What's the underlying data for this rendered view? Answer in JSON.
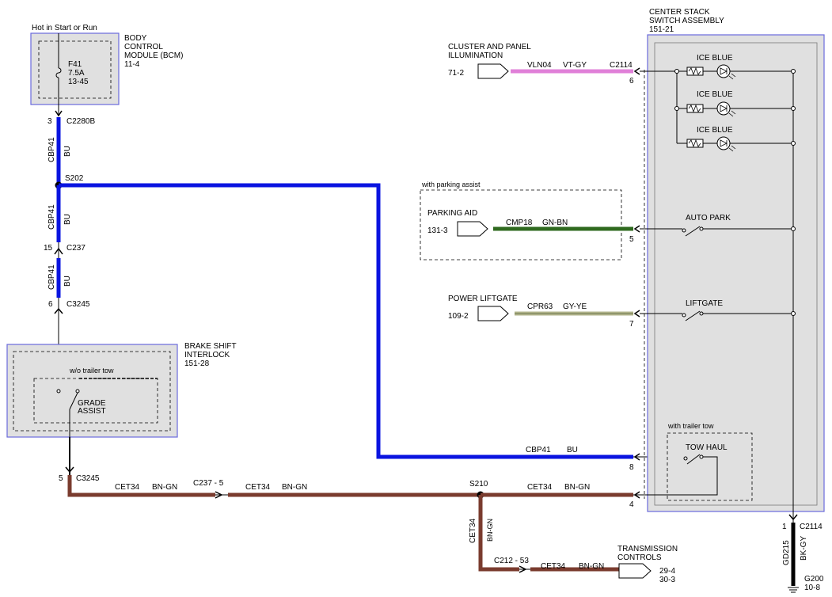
{
  "colors": {
    "bu": "#0a14e0",
    "bn_gn": "#7a3b2e",
    "vt_gy": "#e080d8",
    "gn_bn": "#2f6a1f",
    "gy_ye": "#b2b48c",
    "box_border": "#6a6adc",
    "box_fill": "#e0e0e0",
    "bk_gy": "#000000"
  },
  "power_label": "Hot in Start or Run",
  "bcm": {
    "title_1": "BODY",
    "title_2": "CONTROL",
    "title_3": "MODULE (BCM)",
    "ref": "11-4",
    "fuse_name": "F41",
    "fuse_rating": "7.5A",
    "fuse_ref": "13-45"
  },
  "connectors": {
    "c2280b_pin": "3",
    "c2280b": "C2280B",
    "s202": "S202",
    "c237_pin": "15",
    "c237": "C237",
    "c3245_top_pin": "6",
    "c3245_top": "C3245",
    "c3245_bot_pin": "5",
    "c3245_bot": "C3245",
    "c237_5": "C237 - 5",
    "s210": "S210",
    "c212_53": "C212 - 53",
    "c2114_top": "C2114",
    "c2114_bot_pin": "1",
    "c2114_bot": "C2114"
  },
  "wires": {
    "cbp41": "CBP41",
    "bu": "BU",
    "cet34": "CET34",
    "bn_gn": "BN-GN",
    "vln04": "VLN04",
    "vt_gy": "VT-GY",
    "cmp18": "CMP18",
    "gn_bn": "GN-BN",
    "cpr63": "CPR63",
    "gy_ye": "GY-YE",
    "gd215": "GD215",
    "bk_gy": "BK-GY"
  },
  "pins": {
    "p6": "6",
    "p5": "5",
    "p7": "7",
    "p8": "8",
    "p4": "4"
  },
  "brake": {
    "title_1": "BRAKE SHIFT",
    "title_2": "INTERLOCK",
    "ref": "151-28",
    "option": "w/o trailer tow",
    "switch_1": "GRADE",
    "switch_2": "ASSIST"
  },
  "cluster": {
    "title_1": "CLUSTER AND PANEL",
    "title_2": "ILLUMINATION",
    "ref": "71-2"
  },
  "parking": {
    "option": "with parking assist",
    "title": "PARKING AID",
    "ref": "131-3"
  },
  "liftgate_src": {
    "title": "POWER LIFTGATE",
    "ref": "109-2"
  },
  "transmission": {
    "title_1": "TRANSMISSION",
    "title_2": "CONTROLS",
    "ref_1": "29-4",
    "ref_2": "30-3"
  },
  "center_stack": {
    "title_1": "CENTER STACK",
    "title_2": "SWITCH ASSEMBLY",
    "ref": "151-21",
    "led_1": "ICE BLUE",
    "led_2": "ICE BLUE",
    "led_3": "ICE BLUE",
    "auto_park": "AUTO PARK",
    "liftgate": "LIFTGATE",
    "trailer_option": "with trailer tow",
    "tow_haul": "TOW HAUL"
  },
  "ground": {
    "name": "G200",
    "ref": "10-8"
  }
}
